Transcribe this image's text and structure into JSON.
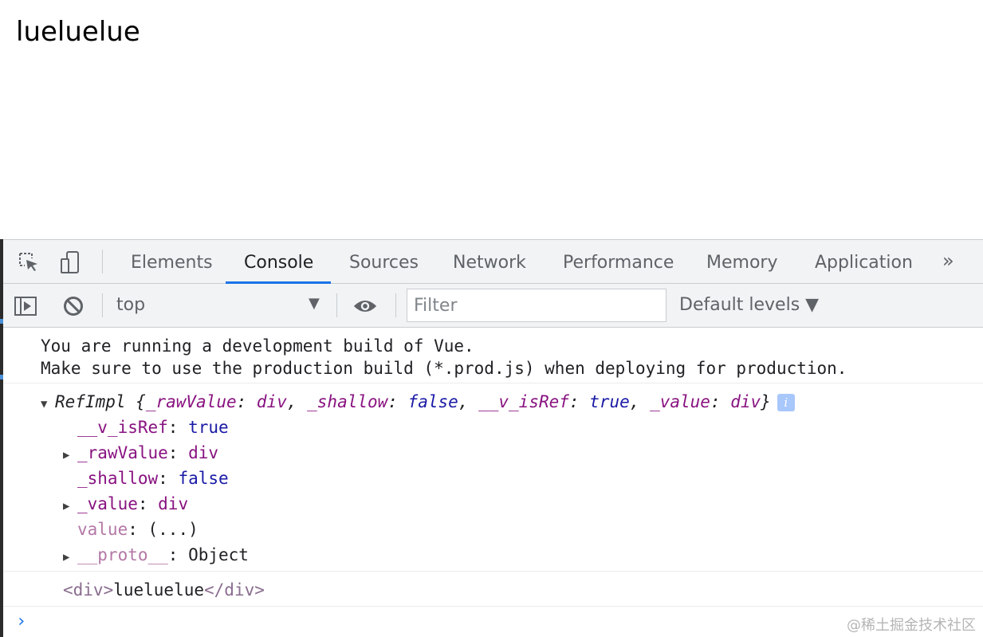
{
  "page": {
    "text": "lueluelue"
  },
  "devtools": {
    "tabs": [
      "Elements",
      "Console",
      "Sources",
      "Network",
      "Performance",
      "Memory",
      "Application"
    ],
    "active_tab": "Console",
    "more_label": "»"
  },
  "toolbar": {
    "context": "top",
    "filter_placeholder": "Filter",
    "levels": "Default levels ▼"
  },
  "console": {
    "vue_msg_line1": "You are running a development build of Vue.",
    "vue_msg_line2": "Make sure to use the production build (*.prod.js) when deploying for production.",
    "ref": {
      "class_name": "RefImpl",
      "preview": {
        "k1": "_rawValue",
        "v1": "div",
        "k2": "_shallow",
        "v2": "false",
        "k3": "__v_isRef",
        "v3": "true",
        "k4": "_value",
        "v4": "div"
      },
      "props": [
        {
          "key": "__v_isRef",
          "value": "true"
        },
        {
          "key": "_rawValue",
          "value": "div"
        },
        {
          "key": "_shallow",
          "value": "false"
        },
        {
          "key": "_value",
          "value": "div"
        },
        {
          "key": "value",
          "value": "(...)"
        },
        {
          "key": "__proto__",
          "value": "Object"
        }
      ]
    },
    "element": {
      "open_tag": "<div>",
      "text": "lueluelue",
      "close_tag": "</div>"
    },
    "prompt": "›"
  },
  "watermark": "@稀土掘金技术社区"
}
